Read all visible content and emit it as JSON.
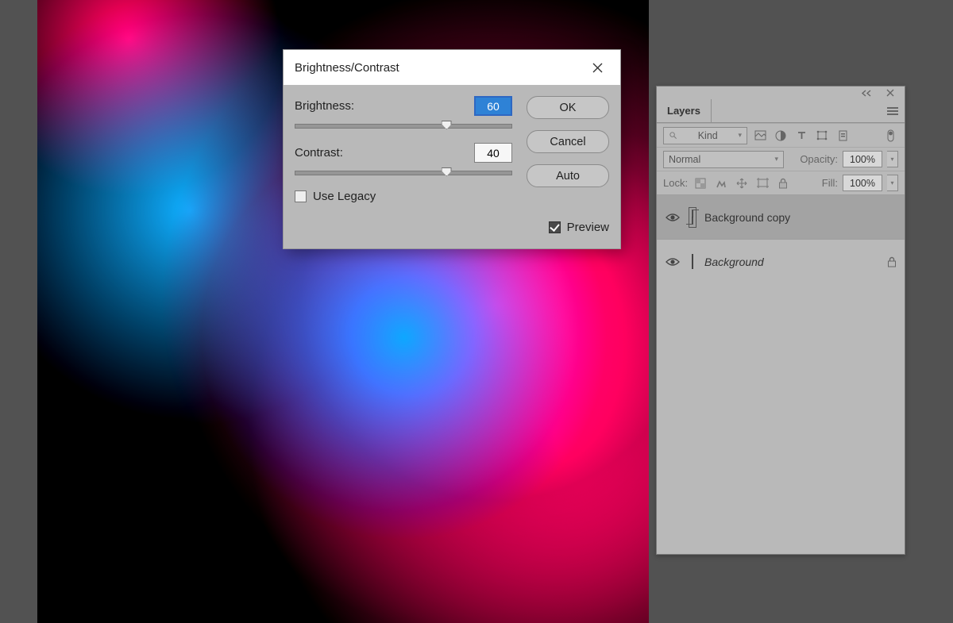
{
  "dialog": {
    "title": "Brightness/Contrast",
    "brightness_label": "Brightness:",
    "brightness_value": "60",
    "brightness_pos_pct": 70,
    "contrast_label": "Contrast:",
    "contrast_value": "40",
    "contrast_pos_pct": 70,
    "use_legacy_label": "Use Legacy",
    "use_legacy_checked": false,
    "preview_label": "Preview",
    "preview_checked": true,
    "ok_label": "OK",
    "cancel_label": "Cancel",
    "auto_label": "Auto"
  },
  "layers_panel": {
    "tab_label": "Layers",
    "kind_placeholder": "Kind",
    "blend_mode": "Normal",
    "opacity_label": "Opacity:",
    "opacity_value": "100%",
    "lock_label": "Lock:",
    "fill_label": "Fill:",
    "fill_value": "100%",
    "layers": [
      {
        "name": "Background copy",
        "selected": true,
        "italic": false,
        "smart": true,
        "locked": false
      },
      {
        "name": "Background",
        "selected": false,
        "italic": true,
        "smart": false,
        "locked": true
      }
    ]
  }
}
